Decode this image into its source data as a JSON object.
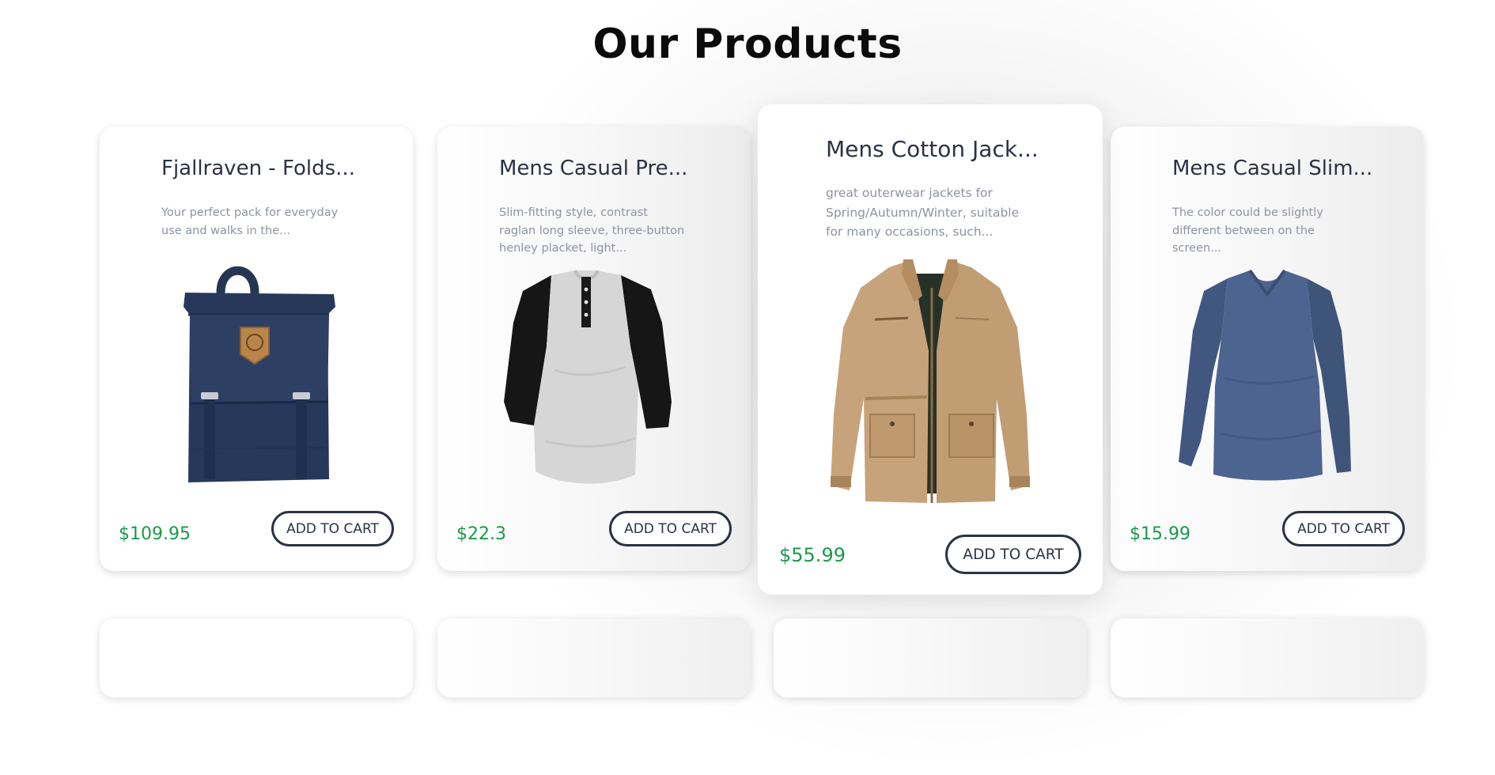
{
  "page": {
    "title": "Our Products"
  },
  "products": [
    {
      "title": "Fjallraven - Folds...",
      "description": "Your perfect pack for everyday use and walks in the...",
      "image_icon": "backpack-image",
      "price": "$109.95",
      "button_label": "ADD TO CART"
    },
    {
      "title": "Mens Casual Pre...",
      "description": "Slim-fitting style, contrast raglan long sleeve, three-button henley placket, light...",
      "image_icon": "henley-shirt-image",
      "price": "$22.3",
      "button_label": "ADD TO CART"
    },
    {
      "title": "Mens Cotton Jack...",
      "description": "great outerwear jackets for Spring/Autumn/Winter, suitable for many occasions, such...",
      "image_icon": "cotton-jacket-image",
      "price": "$55.99",
      "button_label": "ADD TO CART"
    },
    {
      "title": "Mens Casual Slim...",
      "description": "The color could be slightly different between on the screen...",
      "image_icon": "long-sleeve-tee-image",
      "price": "$15.99",
      "button_label": "ADD TO CART"
    }
  ],
  "colors": {
    "price": "#199a4a",
    "heading": "#0b0b0b",
    "text_dark": "#2b3244",
    "text_muted": "#8d93a0"
  }
}
